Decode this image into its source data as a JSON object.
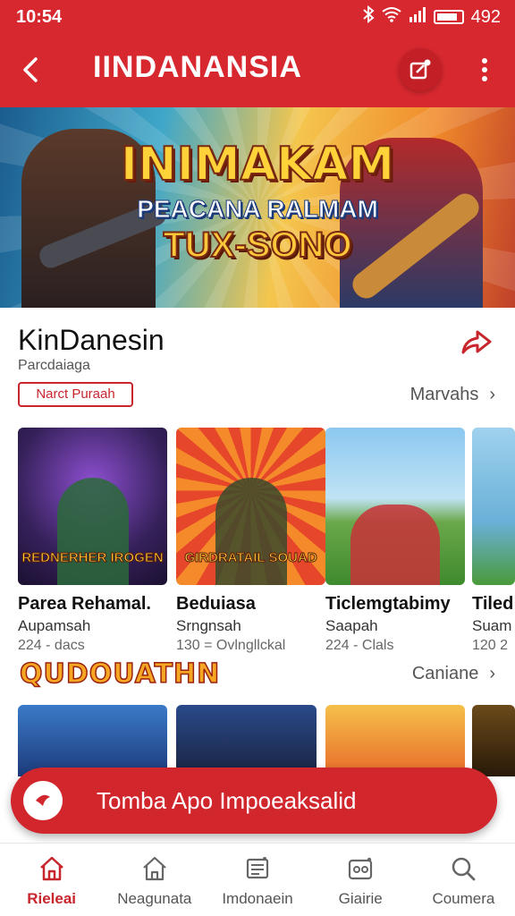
{
  "status_bar": {
    "time": "10:54",
    "battery": "492"
  },
  "app_bar": {
    "title": "IINDANANSIA"
  },
  "hero": {
    "line1": "INIMAKAM",
    "line2": "PEACANA RALMAM",
    "line3": "TUX-SONO"
  },
  "section": {
    "title": "KinDanesin",
    "subtitle": "Parcdaiaga",
    "chip": "Narct Puraah",
    "see_more": "Marvahs"
  },
  "cards": [
    {
      "title": "Parea Rehamal.",
      "subtitle": "Aupamsah",
      "meta": "224 - dacs",
      "thumb_label": "REDNERHER IROGEN"
    },
    {
      "title": "Beduiasa",
      "subtitle": "Srngnsah",
      "meta": "130 = Ovlngllckal",
      "thumb_label": "GIRDRATAIL SOUAD"
    },
    {
      "title": "Ticlemgtabimy",
      "subtitle": "Saapah",
      "meta": "224 - Clals",
      "thumb_label": ""
    },
    {
      "title": "Tiled",
      "subtitle": "Suam",
      "meta": "120 2",
      "thumb_label": ""
    }
  ],
  "section2": {
    "title": "QUDOUATHN",
    "see_more": "Caniane"
  },
  "floating_bar": {
    "label": "Tomba Apo Impoeaksalid"
  },
  "bottom_nav": [
    {
      "label": "Rieleai",
      "icon": "home-icon",
      "active": true
    },
    {
      "label": "Neagunata",
      "icon": "home-outline-icon",
      "active": false
    },
    {
      "label": "Imdonaein",
      "icon": "news-icon",
      "active": false
    },
    {
      "label": "Giairie",
      "icon": "games-icon",
      "active": false
    },
    {
      "label": "Coumera",
      "icon": "search-icon",
      "active": false
    }
  ],
  "colors": {
    "brand": "#d7282f",
    "accent_text": "#c8252c"
  }
}
